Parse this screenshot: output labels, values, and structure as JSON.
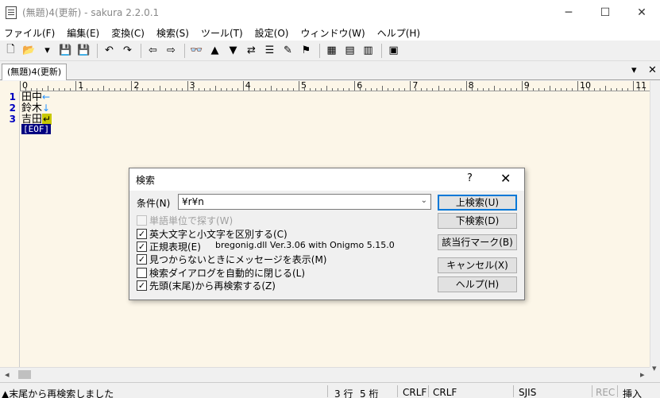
{
  "window": {
    "title": "(無題)4(更新) - sakura 2.2.0.1",
    "min_icon": "─",
    "max_icon": "☐",
    "close_icon": "✕"
  },
  "menu": [
    "ファイル(F)",
    "編集(E)",
    "変換(C)",
    "検索(S)",
    "ツール(T)",
    "設定(O)",
    "ウィンドウ(W)",
    "ヘルプ(H)"
  ],
  "toolbar_icons": [
    {
      "name": "new-file-icon",
      "glyph": "🗋"
    },
    {
      "name": "open-file-icon",
      "glyph": "📂"
    },
    {
      "name": "open-dropdown-icon",
      "glyph": "▾"
    },
    {
      "name": "save-icon",
      "glyph": "💾"
    },
    {
      "name": "save-as-icon",
      "glyph": "💾"
    },
    {
      "sep": true
    },
    {
      "name": "undo-icon",
      "glyph": "↶"
    },
    {
      "name": "redo-icon",
      "glyph": "↷"
    },
    {
      "sep": true
    },
    {
      "name": "jump-back-icon",
      "glyph": "⇦"
    },
    {
      "name": "jump-forward-icon",
      "glyph": "⇨"
    },
    {
      "sep": true
    },
    {
      "name": "search-icon",
      "glyph": "👓"
    },
    {
      "name": "search-prev-icon",
      "glyph": "▲"
    },
    {
      "name": "search-next-icon",
      "glyph": "▼"
    },
    {
      "name": "replace-icon",
      "glyph": "⇄"
    },
    {
      "name": "mark-line-icon",
      "glyph": "☰"
    },
    {
      "name": "clear-mark-icon",
      "glyph": "✎"
    },
    {
      "name": "grep-icon",
      "glyph": "⚑"
    },
    {
      "sep": true
    },
    {
      "name": "outline-icon",
      "glyph": "▦"
    },
    {
      "name": "compare-icon",
      "glyph": "▤"
    },
    {
      "name": "tag-jump-icon",
      "glyph": "▥"
    },
    {
      "sep": true
    },
    {
      "name": "settings-icon",
      "glyph": "▣"
    }
  ],
  "tab": {
    "label": "(無題)4(更新)",
    "menu_icon": "▾",
    "close_icon": "✕"
  },
  "ruler_numbers": [
    "0",
    "1",
    "2",
    "3",
    "4",
    "5",
    "6",
    "7",
    "8",
    "9",
    "10",
    "11"
  ],
  "editor": {
    "lines": [
      {
        "num": "1",
        "text": "田中",
        "eol": "←",
        "eol_style": "arrow"
      },
      {
        "num": "2",
        "text": "鈴木",
        "eol": "↓",
        "eol_style": "arrow"
      },
      {
        "num": "3",
        "text": "吉田",
        "eol": "↵",
        "eol_style": "highlight"
      }
    ],
    "eof": "[EOF]"
  },
  "dialog": {
    "title": "検索",
    "help_icon": "?",
    "close_icon": "✕",
    "condition_label": "条件(N)",
    "condition_value": "¥r¥n",
    "dropdown_icon": "⌄",
    "checkboxes": [
      {
        "label": "単語単位で探す(W)",
        "checked": false,
        "disabled": true
      },
      {
        "label": "英大文字と小文字を区別する(C)",
        "checked": true,
        "disabled": false
      },
      {
        "label": "正規表現(E)",
        "checked": true,
        "disabled": false
      },
      {
        "label": "見つからないときにメッセージを表示(M)",
        "checked": true,
        "disabled": false
      },
      {
        "label": "検索ダイアログを自動的に閉じる(L)",
        "checked": false,
        "disabled": false
      },
      {
        "label": "先頭(末尾)から再検索する(Z)",
        "checked": true,
        "disabled": false
      }
    ],
    "regex_lib": "bregonig.dll Ver.3.06 with Onigmo 5.15.0",
    "buttons": {
      "search_up": "上検索(U)",
      "search_down": "下検索(D)",
      "mark_line": "該当行マーク(B)",
      "cancel": "キャンセル(X)",
      "help": "ヘルプ(H)"
    }
  },
  "status": {
    "message": "▲末尾から再検索しました",
    "line": "3 行",
    "column": "5 桁",
    "eol1": "CRLF",
    "eol2": "CRLF",
    "encoding": "SJIS",
    "rec": "REC",
    "mode": "挿入"
  },
  "colors": {
    "editor_bg": "#fcf6e8",
    "line_number": "#0000c0",
    "eof_bg": "#000080",
    "default_button_border": "#0078d7"
  }
}
